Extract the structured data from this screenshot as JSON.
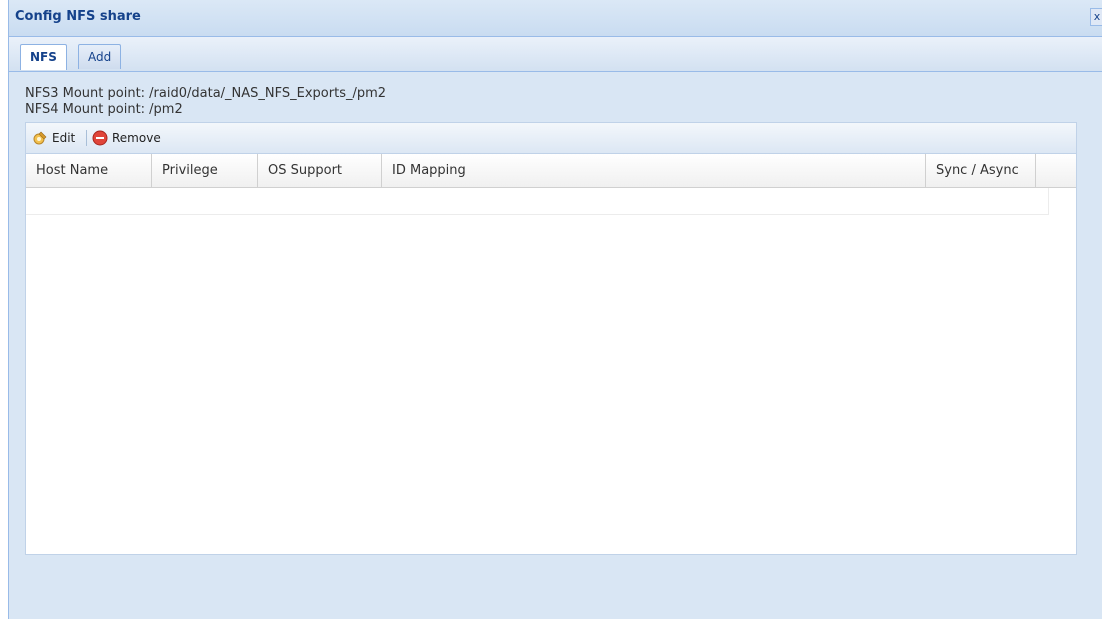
{
  "window": {
    "title": "Config NFS share",
    "close_label": "x"
  },
  "tabs": [
    {
      "label": "NFS",
      "active": true
    },
    {
      "label": "Add",
      "active": false
    }
  ],
  "mount": {
    "nfs3": "NFS3 Mount point: /raid0/data/_NAS_NFS_Exports_/pm2",
    "nfs4": "NFS4 Mount point: /pm2"
  },
  "toolbar": {
    "edit_label": "Edit",
    "edit_icon": "edit-icon",
    "remove_label": "Remove",
    "remove_icon": "remove-icon"
  },
  "grid": {
    "columns": [
      "Host Name",
      "Privilege",
      "OS Support",
      "ID Mapping",
      "Sync / Async"
    ],
    "rows": []
  },
  "colors": {
    "title_text": "#15428b",
    "frame_bg": "#d9e6f4",
    "border": "#99bbe8",
    "remove_red": "#e0453a"
  }
}
